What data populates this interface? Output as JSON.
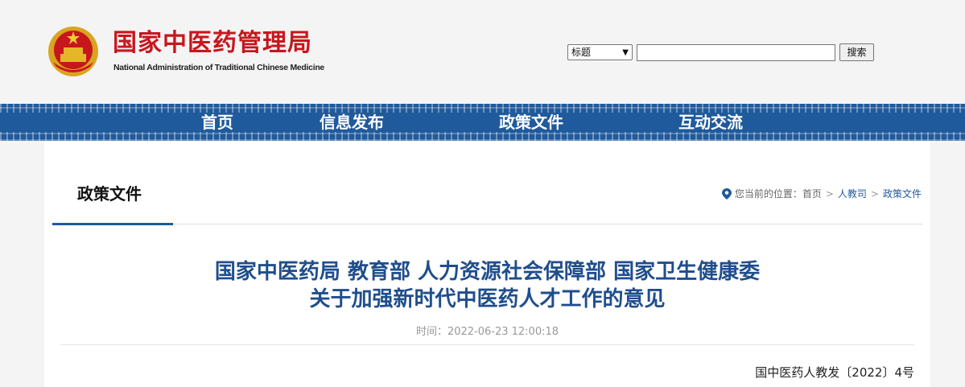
{
  "header": {
    "logo_cn": "国家中医药管理局",
    "logo_en": "National Administration of Traditional Chinese Medicine",
    "emblem_icon": "national-emblem-icon"
  },
  "search": {
    "select_value": "标题",
    "input_value": "",
    "button_label": "搜索"
  },
  "nav": {
    "items": [
      {
        "label": "首页"
      },
      {
        "label": "信息发布"
      },
      {
        "label": "政策文件"
      },
      {
        "label": "互动交流"
      }
    ],
    "color": "#1f5a9c"
  },
  "section": {
    "title": "政策文件"
  },
  "breadcrumb": {
    "prefix": "您当前的位置：",
    "items": [
      {
        "label": "首页"
      },
      {
        "label": "人教司"
      },
      {
        "label": "政策文件"
      }
    ],
    "separator": ">"
  },
  "article": {
    "title_line1": "国家中医药局 教育部 人力资源社会保障部 国家卫生健康委",
    "title_line2": "关于加强新时代中医药人才工作的意见",
    "time": "时间：2022-06-23 12:00:18",
    "doc_number": "国中医药人教发〔2022〕4号"
  },
  "colors": {
    "brand_red": "#c8161d",
    "title_blue": "#1f4e8c"
  }
}
